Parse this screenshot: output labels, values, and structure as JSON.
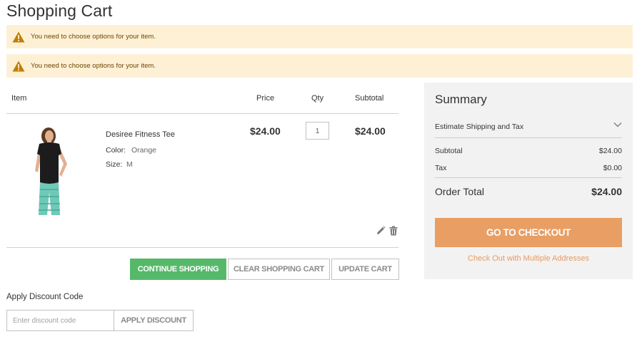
{
  "page": {
    "title": "Shopping Cart"
  },
  "messages": [
    {
      "text": "You need to choose options for your item."
    },
    {
      "text": "You need to choose options for your item."
    }
  ],
  "cart": {
    "headers": {
      "item": "Item",
      "price": "Price",
      "qty": "Qty",
      "subtotal": "Subtotal"
    },
    "items": [
      {
        "name": "Desiree Fitness Tee",
        "options": [
          {
            "label": "Color:",
            "value": "Orange"
          },
          {
            "label": "Size:",
            "value": "M"
          }
        ],
        "price": "$24.00",
        "qty": "1",
        "subtotal": "$24.00"
      }
    ],
    "actions": {
      "continue": "CONTINUE SHOPPING",
      "clear": "CLEAR SHOPPING CART",
      "update": "UPDATE CART"
    },
    "icons": {
      "edit": "pencil-icon",
      "delete": "trash-icon"
    }
  },
  "discount": {
    "title": "Apply Discount Code",
    "placeholder": "Enter discount code",
    "button": "APPLY DISCOUNT"
  },
  "summary": {
    "title": "Summary",
    "estimate": "Estimate Shipping and Tax",
    "subtotal_label": "Subtotal",
    "subtotal_value": "$24.00",
    "tax_label": "Tax",
    "tax_value": "$0.00",
    "total_label": "Order Total",
    "total_value": "$24.00",
    "checkout": "GO TO CHECKOUT",
    "multi_address": "Check Out with Multiple Addresses"
  },
  "colors": {
    "message_bg": "#fdf0d5",
    "warning_icon": "#c07f00",
    "continue_button": "#56b96a",
    "checkout_button": "#e99e63",
    "link": "#e79b62",
    "summary_bg": "#f2f2f2"
  }
}
